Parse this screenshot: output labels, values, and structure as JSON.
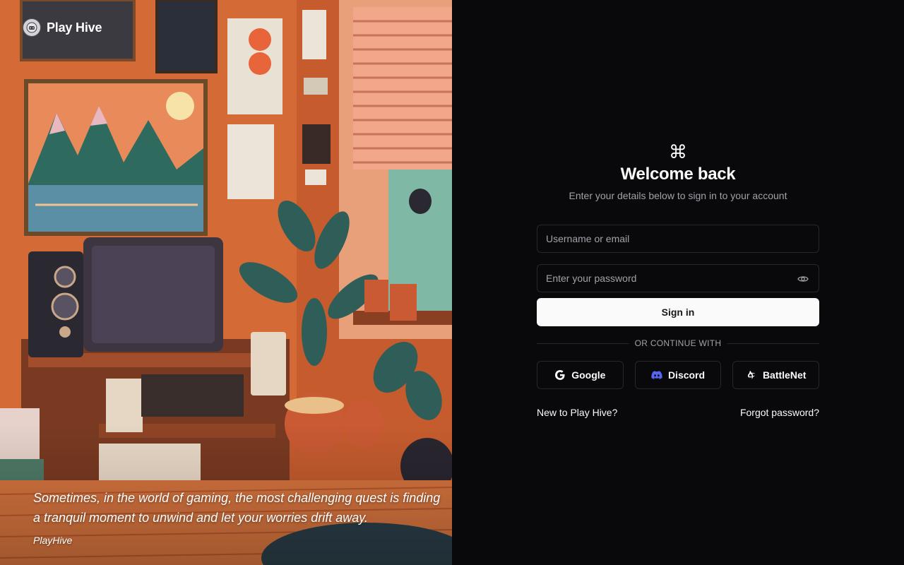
{
  "brand": {
    "name": "Play Hive",
    "logo_icon": "controller-avatar-icon"
  },
  "hero": {
    "quote": "Sometimes, in the world of gaming, the most challenging quest is finding a tranquil moment to unwind and let your worries drift away.",
    "author": "PlayHive"
  },
  "auth": {
    "icon": "command-icon",
    "title": "Welcome back",
    "subtitle": "Enter your details below to sign in to your account",
    "username_placeholder": "Username or email",
    "username_value": "",
    "password_placeholder": "Enter your password",
    "password_value": "",
    "password_toggle_icon": "eye-icon",
    "signin_label": "Sign in",
    "divider_label": "OR CONTINUE WITH",
    "providers": [
      {
        "label": "Google",
        "icon": "google-icon"
      },
      {
        "label": "Discord",
        "icon": "discord-icon",
        "color": "#5865f2"
      },
      {
        "label": "BattleNet",
        "icon": "battlenet-icon"
      }
    ],
    "signup_link": "New to Play Hive?",
    "forgot_link": "Forgot password?"
  },
  "colors": {
    "background": "#09090b",
    "border": "#27272a",
    "muted_text": "#a1a1aa",
    "primary_button": "#fafafa"
  }
}
